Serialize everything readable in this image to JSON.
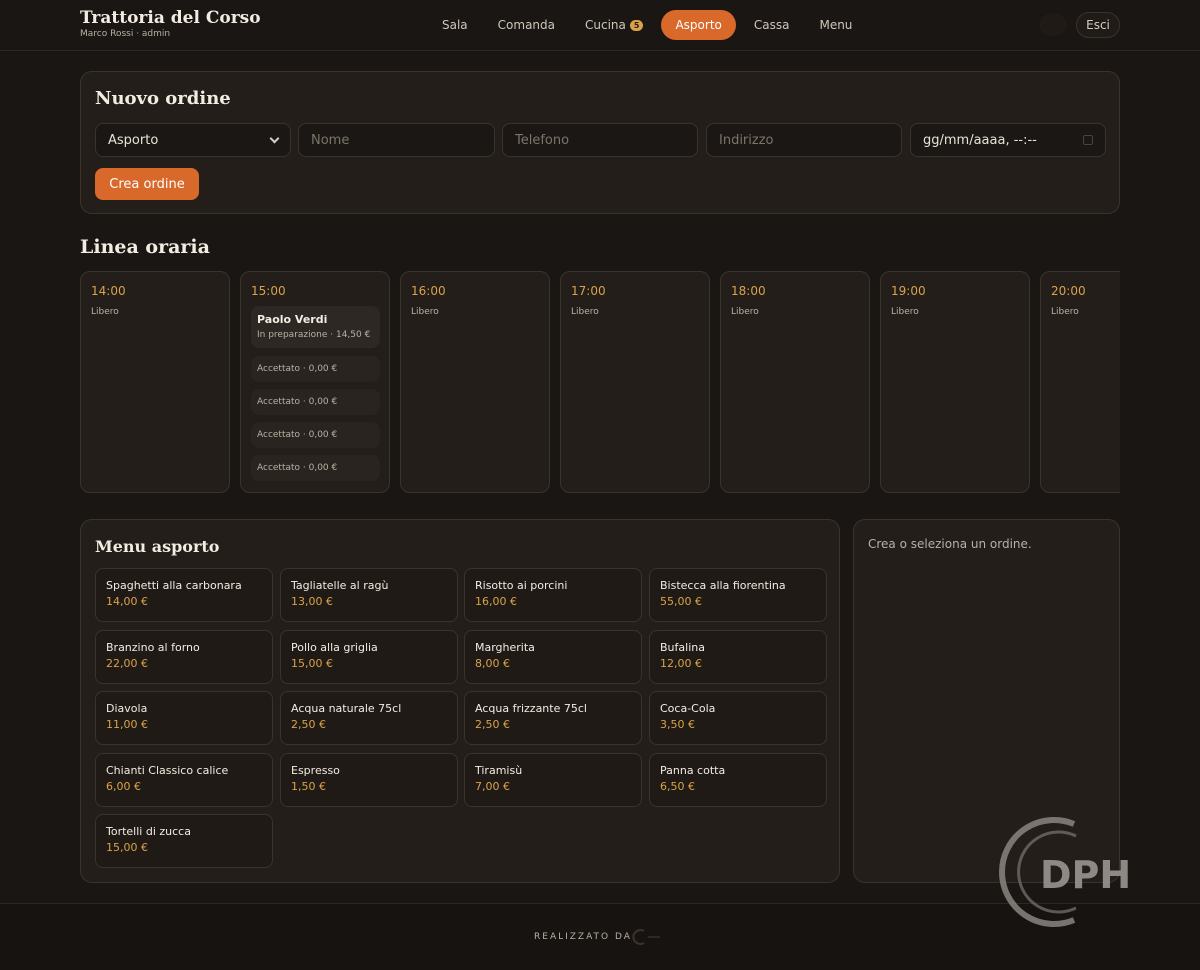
{
  "header": {
    "title": "Trattoria del Corso",
    "subtitle": "Marco Rossi · admin",
    "nav": [
      {
        "label": "Sala",
        "active": false
      },
      {
        "label": "Comanda",
        "active": false
      },
      {
        "label": "Cucina",
        "active": false,
        "badge": "5"
      },
      {
        "label": "Asporto",
        "active": true
      },
      {
        "label": "Cassa",
        "active": false
      },
      {
        "label": "Menu",
        "active": false
      }
    ],
    "logout_label": "Esci"
  },
  "new_order": {
    "title": "Nuovo ordine",
    "type_selected": "Asporto",
    "name_placeholder": "Nome",
    "phone_placeholder": "Telefono",
    "address_placeholder": "Indirizzo",
    "datetime_placeholder": "gg/mm/aaaa, --:--",
    "create_label": "Crea ordine"
  },
  "timeline": {
    "title": "Linea oraria",
    "slots": [
      {
        "time": "14:00",
        "status": "Libero"
      },
      {
        "time": "15:00",
        "orders": [
          {
            "name": "Paolo Verdi",
            "meta": "In preparazione · 14,50 €"
          },
          {
            "meta": "Accettato · 0,00 €"
          },
          {
            "meta": "Accettato · 0,00 €"
          },
          {
            "meta": "Accettato · 0,00 €"
          },
          {
            "meta": "Accettato · 0,00 €"
          }
        ]
      },
      {
        "time": "16:00",
        "status": "Libero"
      },
      {
        "time": "17:00",
        "status": "Libero"
      },
      {
        "time": "18:00",
        "status": "Libero"
      },
      {
        "time": "19:00",
        "status": "Libero"
      },
      {
        "time": "20:00",
        "status": "Libero"
      }
    ]
  },
  "menu": {
    "title": "Menu asporto",
    "items": [
      {
        "name": "Spaghetti alla carbonara",
        "price": "14,00 €"
      },
      {
        "name": "Tagliatelle al ragù",
        "price": "13,00 €"
      },
      {
        "name": "Risotto ai porcini",
        "price": "16,00 €"
      },
      {
        "name": "Bistecca alla fiorentina",
        "price": "55,00 €"
      },
      {
        "name": "Branzino al forno",
        "price": "22,00 €"
      },
      {
        "name": "Pollo alla griglia",
        "price": "15,00 €"
      },
      {
        "name": "Margherita",
        "price": "8,00 €"
      },
      {
        "name": "Bufalina",
        "price": "12,00 €"
      },
      {
        "name": "Diavola",
        "price": "11,00 €"
      },
      {
        "name": "Acqua naturale 75cl",
        "price": "2,50 €"
      },
      {
        "name": "Acqua frizzante 75cl",
        "price": "2,50 €"
      },
      {
        "name": "Coca-Cola",
        "price": "3,50 €"
      },
      {
        "name": "Chianti Classico calice",
        "price": "6,00 €"
      },
      {
        "name": "Espresso",
        "price": "1,50 €"
      },
      {
        "name": "Tiramisù",
        "price": "7,00 €"
      },
      {
        "name": "Panna cotta",
        "price": "6,50 €"
      },
      {
        "name": "Tortelli di zucca",
        "price": "15,00 €"
      }
    ]
  },
  "side_panel": {
    "message": "Crea o seleziona un ordine."
  },
  "footer": {
    "credit": "REALIZZATO DA"
  },
  "watermark": {
    "text": "DPH"
  },
  "colors": {
    "background": "#1a1613",
    "card": "#231e1a",
    "accent": "#d9692a",
    "price": "#d9a24a",
    "border": "#3a332c"
  }
}
